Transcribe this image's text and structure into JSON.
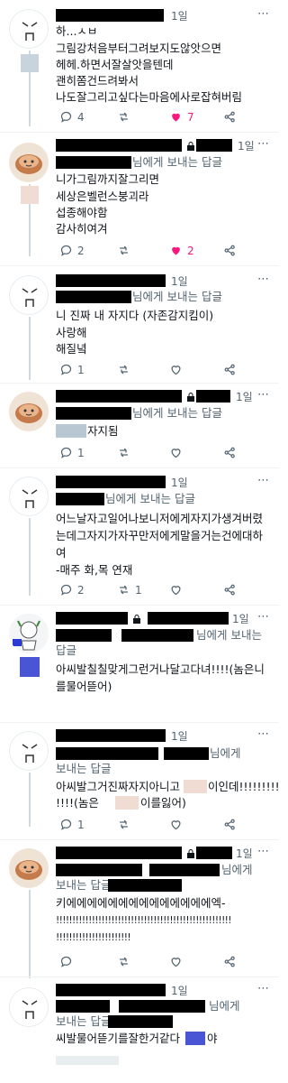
{
  "colors": {
    "accent_heart": "#f91880",
    "muted": "#536471",
    "highlight_blue": "#4a55d6",
    "highlight_pink": "#f1dcd4",
    "highlight_gray": "#b9c7d3"
  },
  "common": {
    "time": "1일",
    "more": "⋯",
    "reply_suffix": "님에게 보내는 답글",
    "reply_suffix_head": "님에게",
    "reply_suffix_tail": "보내는 답글",
    "reply_suffix_wrap_head": "님에게 보내는",
    "reply_suffix_wrap_tail": "답글"
  },
  "t1": {
    "lines": [
      "하...ㅅㅂ",
      "그림강처음부터그려보지도않앗으면",
      "헤헤.하면서잘살앗을텐데",
      "괜히쫌건드려봐서",
      "나도잘그리고싶다는마음에사로잡혀버림"
    ],
    "reply": "4",
    "like": "7"
  },
  "t2": {
    "lines": [
      "니가그림까지잘그리면",
      "세상은벨런스붕괴라",
      "섭종해야함",
      "감사히여겨"
    ],
    "reply": "2",
    "like": "2"
  },
  "t3": {
    "lines": [
      "니 진짜 내 자지다 (자존감지킴이)",
      "사랑해",
      "해질녘"
    ],
    "reply": "1"
  },
  "t4": {
    "text": "자지됨",
    "reply": "1"
  },
  "t5": {
    "lines": [
      "어느날자고일어나보니저에게자지가생겨버렸",
      "는데그자지가자꾸만저에게말을거는건에대하",
      "여",
      "-매주 화,목 연재"
    ],
    "reply": "2",
    "retweet": "1"
  },
  "t6": {
    "lines": [
      "아씨발칠칠맞게그런거나달고다녀!!!!(놈은니",
      "를물어뜯어)"
    ]
  },
  "t7": {
    "line1_a": "아씨발그거진짜자지아니고",
    "line1_b": "이인데!!!!!!!!!",
    "line2_a": "!!!!(놈은",
    "line2_b": "이를잃어)",
    "reply": "1"
  },
  "t8": {
    "lines": [
      "키에에에에에에에에에에에에에에엑-",
      "!!!!!!!!!!!!!!!!!!!!!!!!!!!!!!!!!!!!!!!!!!!!!!!!!!!!!!",
      "!!!!!!!!!!!!!!!!!!!!!!!"
    ]
  },
  "t9": {
    "text_a": "씨발물어뜯기를잘한거같다",
    "text_b": "야"
  }
}
